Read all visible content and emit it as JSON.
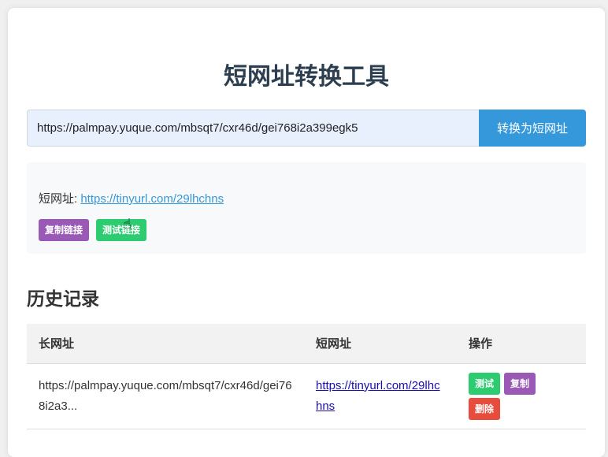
{
  "title": "短网址转换工具",
  "input": {
    "value": "https://palmpay.yuque.com/mbsqt7/cxr46d/gei768i2a399egk5"
  },
  "convert_button": "转换为短网址",
  "result": {
    "label": "短网址: ",
    "short_url": "https://tinyurl.com/29lhchns",
    "copy_button": "复制链接",
    "test_button": "测试链接"
  },
  "history": {
    "heading": "历史记录",
    "columns": [
      "长网址",
      "短网址",
      "操作"
    ],
    "rows": [
      {
        "long_url": "https://palmpay.yuque.com/mbsqt7/cxr46d/gei768i2a3...",
        "short_url": "https://tinyurl.com/29lhchns",
        "test": "测试",
        "copy": "复制",
        "delete": "删除"
      }
    ]
  }
}
